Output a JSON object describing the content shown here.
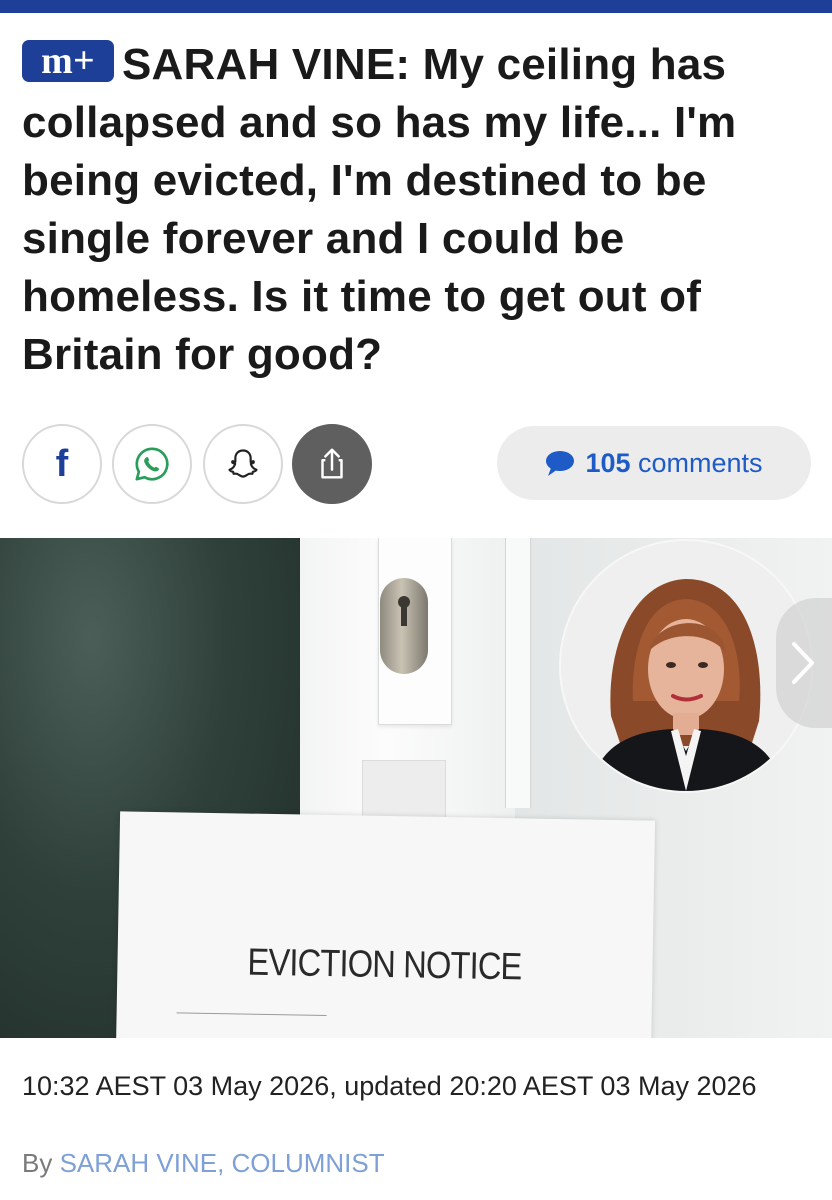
{
  "brand": {
    "badge_label": "m+",
    "accent_color": "#1e3f98"
  },
  "article": {
    "headline": "SARAH VINE: My ceiling has collapsed and so has my life... I'm being evicted, I'm destined to be single forever and I could be homeless. Is it time to get out of Britain for good?",
    "image_sign_text": "EVICTION NOTICE",
    "timestamp": "10:32 AEST 03 May 2026, updated 20:20 AEST 03 May 2026",
    "byline_prefix": "By",
    "author": "SARAH VINE, COLUMNIST"
  },
  "share": {
    "icons": [
      "facebook-icon",
      "whatsapp-icon",
      "snapchat-icon",
      "share-icon"
    ],
    "facebook_label": "f"
  },
  "comments": {
    "count": "105",
    "label": "comments",
    "icon": "speech-bubble-icon",
    "color": "#1e5bc6"
  }
}
